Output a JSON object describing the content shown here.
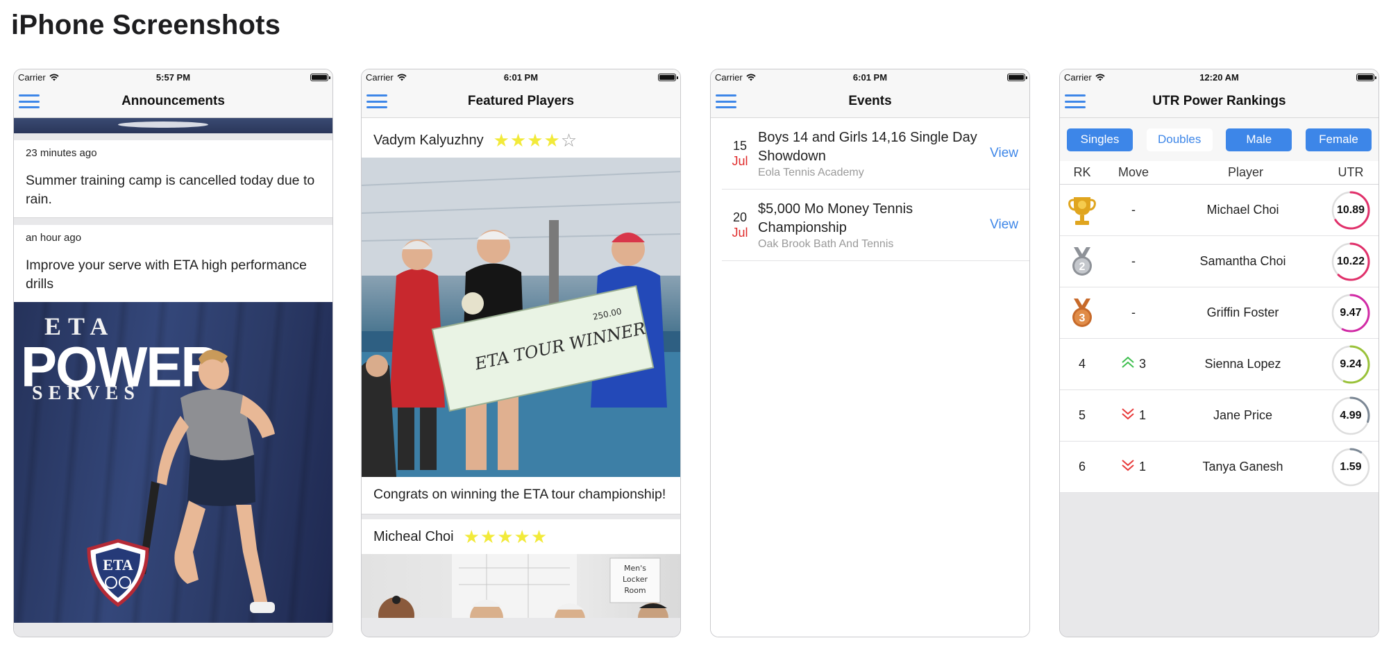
{
  "page": {
    "title": "iPhone Screenshots"
  },
  "colors": {
    "accent": "#3d86e8",
    "star": "#f2ea3a",
    "month": "#e02a2a",
    "up": "#3fbf4f",
    "down": "#e83a3a"
  },
  "phones": [
    {
      "status": {
        "carrier": "Carrier",
        "time": "5:57 PM"
      },
      "nav": {
        "title": "Announcements",
        "menu_icon": "hamburger-icon"
      },
      "announcements": [
        {
          "time": "23 minutes ago",
          "text": "Summer training camp is cancelled today due to rain."
        },
        {
          "time": "an hour ago",
          "text": "Improve your serve with ETA high performance drills"
        }
      ],
      "promo": {
        "line1": "ETA",
        "line2": "POWER",
        "line3": "SERVES",
        "badge": "ETA"
      }
    },
    {
      "status": {
        "carrier": "Carrier",
        "time": "6:01 PM"
      },
      "nav": {
        "title": "Featured Players",
        "menu_icon": "hamburger-icon"
      },
      "players": [
        {
          "name": "Vadym Kalyuzhny",
          "rating": 4,
          "caption": "Congrats on winning the ETA tour championship!"
        },
        {
          "name": "Micheal Choi",
          "rating": 5
        }
      ],
      "check": {
        "text": "ETA TOUR WINNER",
        "amount": "250.00"
      },
      "sign": {
        "line1": "Men's",
        "line2": "Locker",
        "line3": "Room"
      }
    },
    {
      "status": {
        "carrier": "Carrier",
        "time": "6:01 PM"
      },
      "nav": {
        "title": "Events",
        "menu_icon": "hamburger-icon"
      },
      "events": [
        {
          "day": "15",
          "month": "Jul",
          "title": "Boys 14 and Girls 14,16 Single Day Showdown",
          "venue": "Eola Tennis Academy",
          "action": "View"
        },
        {
          "day": "20",
          "month": "Jul",
          "title": "$5,000 Mo Money Tennis Championship",
          "venue": "Oak Brook Bath And Tennis",
          "action": "View"
        }
      ]
    },
    {
      "status": {
        "carrier": "Carrier",
        "time": "12:20 AM"
      },
      "nav": {
        "title": "UTR Power Rankings",
        "menu_icon": "hamburger-icon"
      },
      "filters": [
        {
          "label": "Singles",
          "active": true
        },
        {
          "label": "Doubles",
          "active": false
        },
        {
          "label": "Male",
          "active": true
        },
        {
          "label": "Female",
          "active": true
        }
      ],
      "columns": {
        "rank": "RK",
        "move": "Move",
        "player": "Player",
        "utr": "UTR"
      },
      "rows": [
        {
          "rank": "1",
          "medal": "gold-trophy-icon",
          "move": "-",
          "direction": "none",
          "player": "Michael Choi",
          "utr": "10.89"
        },
        {
          "rank": "2",
          "medal": "silver-medal-icon",
          "move": "-",
          "direction": "none",
          "player": "Samantha Choi",
          "utr": "10.22"
        },
        {
          "rank": "3",
          "medal": "bronze-medal-icon",
          "move": "-",
          "direction": "none",
          "player": "Griffin Foster",
          "utr": "9.47"
        },
        {
          "rank": "4",
          "move": "3",
          "direction": "up",
          "player": "Sienna Lopez",
          "utr": "9.24"
        },
        {
          "rank": "5",
          "move": "1",
          "direction": "down",
          "player": "Jane Price",
          "utr": "4.99"
        },
        {
          "rank": "6",
          "move": "1",
          "direction": "down",
          "player": "Tanya Ganesh",
          "utr": "1.59"
        }
      ]
    }
  ]
}
